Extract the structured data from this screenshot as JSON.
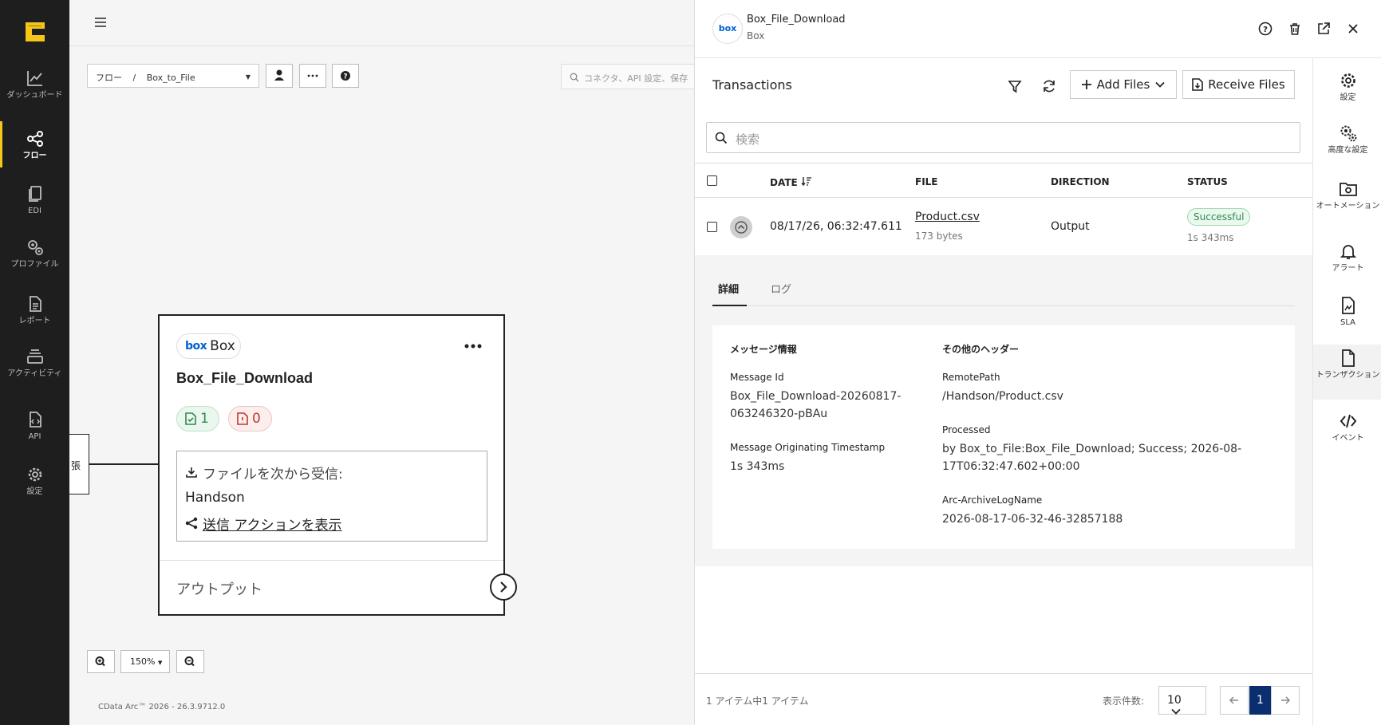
{
  "nav": {
    "items": [
      {
        "label": "ダッシュボード",
        "icon": "chart-line-icon"
      },
      {
        "label": "フロー",
        "icon": "share-icon"
      },
      {
        "label": "EDI",
        "icon": "documents-icon"
      },
      {
        "label": "プロファイル",
        "icon": "gears-icon"
      },
      {
        "label": "レポート",
        "icon": "report-icon"
      },
      {
        "label": "アクティビティ",
        "icon": "layers-icon"
      },
      {
        "label": "API",
        "icon": "api-file-icon"
      },
      {
        "label": "設定",
        "icon": "gear-icon"
      }
    ],
    "accent": "#f5c518"
  },
  "canvas": {
    "breadcrumb_root": "フロー",
    "breadcrumb_sep": "/",
    "breadcrumb_flow": "Box_to_File",
    "search_placeholder": "コネクタ、API 設定、保存",
    "zoom_level": "150%",
    "footer": "CData Arc™ 2026 - 26.3.9712.0",
    "left_stub_text": "張"
  },
  "node": {
    "connector_label": "Box",
    "title": "Box_File_Download",
    "success_count": "1",
    "error_count": "0",
    "receive_label": "ファイルを次から受信:",
    "receive_source": "Handson",
    "send_action_link": "送信 アクションを表示",
    "output_label": "アウトプット"
  },
  "panel": {
    "title": "Box_File_Download",
    "subtitle": "Box",
    "logo_text": "box",
    "transactions_title": "Transactions",
    "add_files_label": "Add Files",
    "receive_files_label": "Receive Files",
    "search_placeholder": "検索",
    "columns": {
      "date": "DATE",
      "file": "FILE",
      "direction": "DIRECTION",
      "status": "STATUS"
    },
    "row": {
      "date": "08/17/26, 06:32:47.611",
      "file": "Product.csv",
      "size": "173 bytes",
      "direction": "Output",
      "status": "Successful",
      "duration": "1s 343ms"
    },
    "detail_tabs": [
      "詳細",
      "ログ"
    ],
    "message_info": {
      "heading": "メッセージ情報",
      "message_id_label": "Message Id",
      "message_id_line1": "Box_File_Download-20260817-",
      "message_id_line2": "063246320-pBAu",
      "timestamp_label": "Message Originating Timestamp",
      "timestamp_value": "1s 343ms"
    },
    "other_headers": {
      "heading": "その他のヘッダー",
      "remote_path_label": "RemotePath",
      "remote_path_value": "/Handson/Product.csv",
      "processed_label": "Processed",
      "processed_line1": "by Box_to_File:Box_File_Download; Success; 2026-08-",
      "processed_line2": "17T06:32:47.602+00:00",
      "archive_label": "Arc-ArchiveLogName",
      "archive_value": "2026-08-17-06-32-46-32857188"
    },
    "pager": {
      "info": "1 アイテム中1 アイテム",
      "per_page_label": "表示件数:",
      "per_page_value": "10",
      "current_page": "1"
    }
  },
  "rail": {
    "items": [
      {
        "label": "設定",
        "icon": "gear-icon"
      },
      {
        "label": "高度な設定",
        "icon": "gears-icon"
      },
      {
        "label": "オートメーション",
        "icon": "folder-gear-icon"
      },
      {
        "label": "アラート",
        "icon": "bell-icon"
      },
      {
        "label": "SLA",
        "icon": "sla-doc-icon"
      },
      {
        "label": "トランザクション",
        "icon": "document-icon"
      },
      {
        "label": "イベント",
        "icon": "code-icon"
      }
    ]
  }
}
